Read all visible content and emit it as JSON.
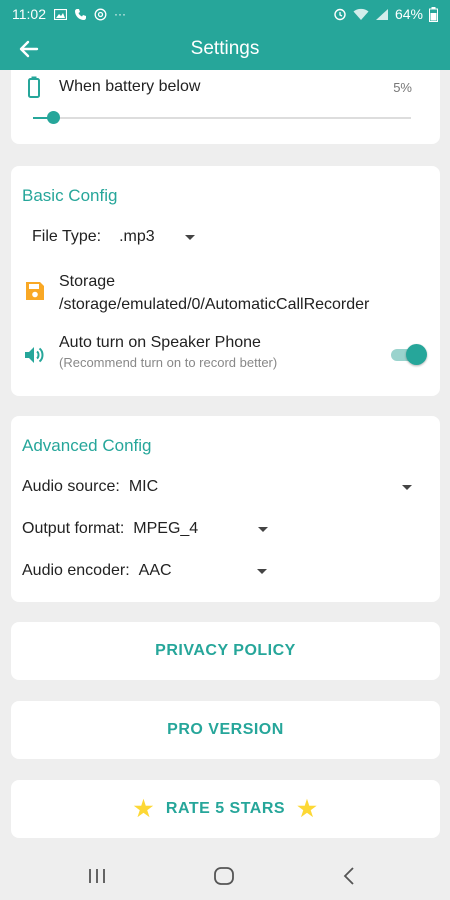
{
  "status_bar": {
    "time": "11:02",
    "battery_percent": "64%"
  },
  "app_bar": {
    "title": "Settings"
  },
  "battery_card": {
    "label": "When battery below",
    "value": "5%",
    "slider_fraction": 0.05
  },
  "basic_config": {
    "title": "Basic Config",
    "file_type_label": "File Type:",
    "file_type_value": ".mp3",
    "storage_label": "Storage",
    "storage_path": "/storage/emulated/0/AutomaticCallRecorder",
    "speaker_label": "Auto turn on Speaker Phone",
    "speaker_hint": "(Recommend turn on to record better)",
    "speaker_enabled": true
  },
  "advanced_config": {
    "title": "Advanced Config",
    "audio_source_label": "Audio source:",
    "audio_source_value": "MIC",
    "output_format_label": "Output format:",
    "output_format_value": "MPEG_4",
    "audio_encoder_label": "Audio encoder:",
    "audio_encoder_value": "AAC"
  },
  "buttons": {
    "privacy_policy": "PRIVACY POLICY",
    "pro_version": "PRO VERSION",
    "rate_stars": "RATE 5 STARS"
  },
  "colors": {
    "accent": "#26a69a",
    "star": "#fdd835",
    "storage_icon": "#f9a825"
  }
}
